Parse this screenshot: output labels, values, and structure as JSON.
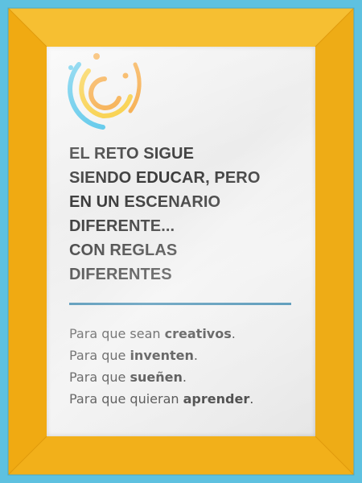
{
  "colors": {
    "frame_outer": "#5ec1e0",
    "frame_gold": "#f3b31c",
    "divider": "#2f7fa8",
    "logo_blue": "#3dbde6",
    "logo_orange": "#f49a22",
    "logo_yellow": "#f7c51e",
    "text": "#3a3a3a"
  },
  "logo": {
    "icon": "circular-c-logo-icon"
  },
  "headline": {
    "lines": [
      "EL RETO SIGUE",
      "SIENDO EDUCAR, PERO",
      "EN UN ESCENARIO",
      "DIFERENTE...",
      "CON REGLAS",
      "DIFERENTES"
    ]
  },
  "statements": [
    {
      "prefix": "Para que sean ",
      "bold": "creativos",
      "suffix": "."
    },
    {
      "prefix": "Para que ",
      "bold": "inventen",
      "suffix": "."
    },
    {
      "prefix": "Para que ",
      "bold": "sueñen",
      "suffix": "."
    },
    {
      "prefix": "Para que quieran ",
      "bold": "aprender",
      "suffix": "."
    }
  ]
}
